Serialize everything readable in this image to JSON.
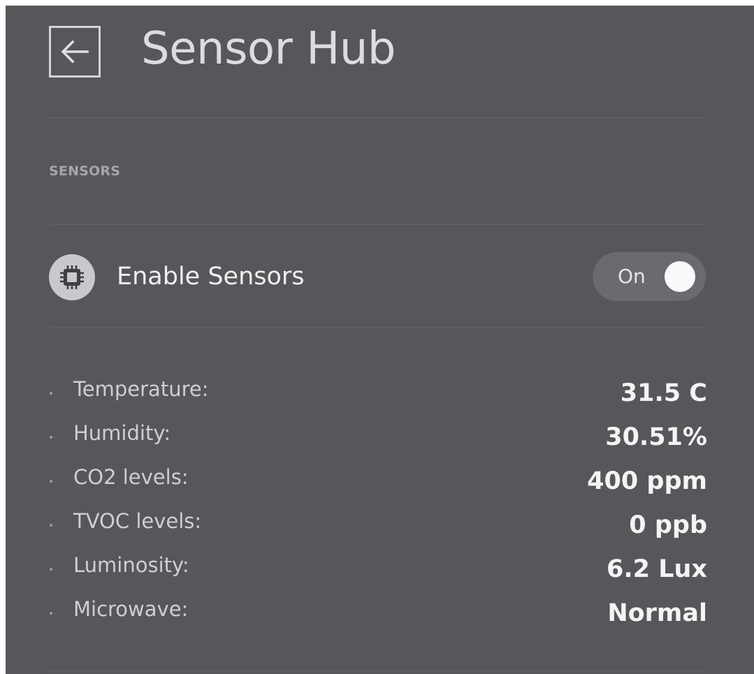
{
  "header": {
    "title": "Sensor Hub",
    "back_icon": "arrow-left-icon"
  },
  "section": {
    "title": "SENSORS"
  },
  "setting": {
    "icon": "chip-icon",
    "label": "Enable Sensors",
    "toggle": {
      "state_label": "On",
      "value": true
    }
  },
  "readings": [
    {
      "label": "Temperature:",
      "value": "31.5 C"
    },
    {
      "label": "Humidity:",
      "value": "30.51%"
    },
    {
      "label": "CO2 levels:",
      "value": "400 ppm"
    },
    {
      "label": "TVOC levels:",
      "value": "0 ppb"
    },
    {
      "label": "Luminosity:",
      "value": "6.2 Lux"
    },
    {
      "label": "Microwave:",
      "value": "Normal"
    }
  ],
  "colors": {
    "panel_background": "#57565b",
    "toggle_track": "#6b6a6f",
    "toggle_knob": "#fafafa"
  }
}
